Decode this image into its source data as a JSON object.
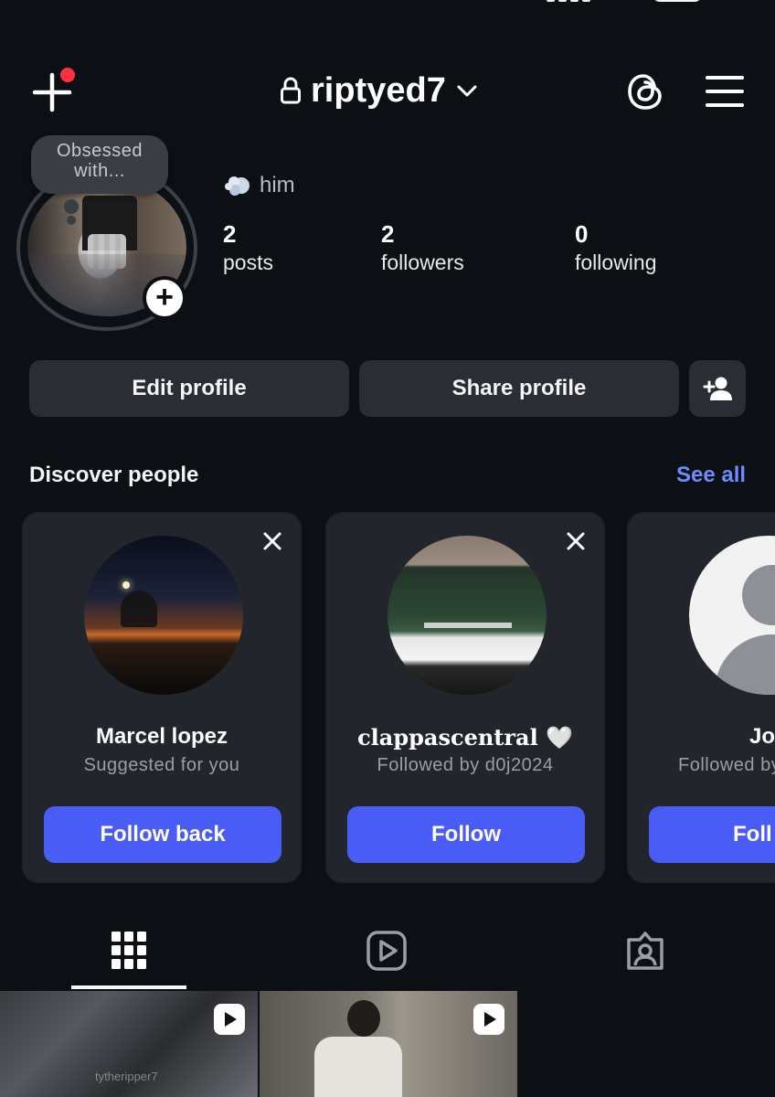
{
  "header": {
    "username": "riptyed7",
    "icons": {
      "new_post": "plus-icon",
      "lock": "lock-icon",
      "dropdown": "chevron-down-icon",
      "threads": "threads-icon",
      "menu": "hamburger-menu-icon"
    },
    "notification_color": "#ff3040"
  },
  "profile": {
    "note": "Obsessed with...",
    "bio_text": "him",
    "bio_emoji": "dashing-away-emoji",
    "stats": [
      {
        "value": "2",
        "label": "posts"
      },
      {
        "value": "2",
        "label": "followers"
      },
      {
        "value": "0",
        "label": "following"
      }
    ]
  },
  "actions": {
    "edit_profile": "Edit profile",
    "share_profile": "Share profile",
    "add_friend_icon": "add-person-icon"
  },
  "discover": {
    "title": "Discover people",
    "see_all": "See all",
    "cards": [
      {
        "name": "Marcel lopez",
        "subtitle": "Suggested for you",
        "button": "Follow back"
      },
      {
        "name": "clappascentral 🤍",
        "subtitle": "Followed by d0j2024",
        "button": "Follow"
      },
      {
        "name": "Jo",
        "subtitle": "Followed by",
        "button": "Foll"
      }
    ]
  },
  "tabs": [
    "grid-icon",
    "reels-icon",
    "tagged-icon"
  ],
  "grid": {
    "watermark": "tytheripper7"
  },
  "colors": {
    "background": "#0c0f14",
    "accent_link": "#6c8cff",
    "follow_button": "#4a5cf6",
    "card": "#22252b"
  }
}
